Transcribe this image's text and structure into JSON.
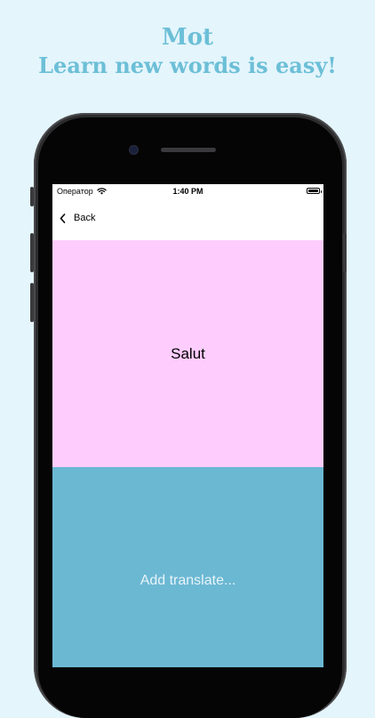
{
  "promo": {
    "title": "Mot",
    "subtitle": "Learn new words is easy!"
  },
  "status_bar": {
    "carrier": "Оператор",
    "time": "1:40 PM",
    "icons": [
      "wifi-icon",
      "battery-icon"
    ]
  },
  "nav": {
    "back_label": "Back",
    "back_icon": "chevron-left-icon"
  },
  "card": {
    "word": "Salut",
    "translate_placeholder": "Add translate..."
  },
  "colors": {
    "background": "#e4f5fc",
    "headline": "#6cbfd7",
    "word_card": "#fecdfe",
    "translate_card": "#6bb8d3"
  }
}
